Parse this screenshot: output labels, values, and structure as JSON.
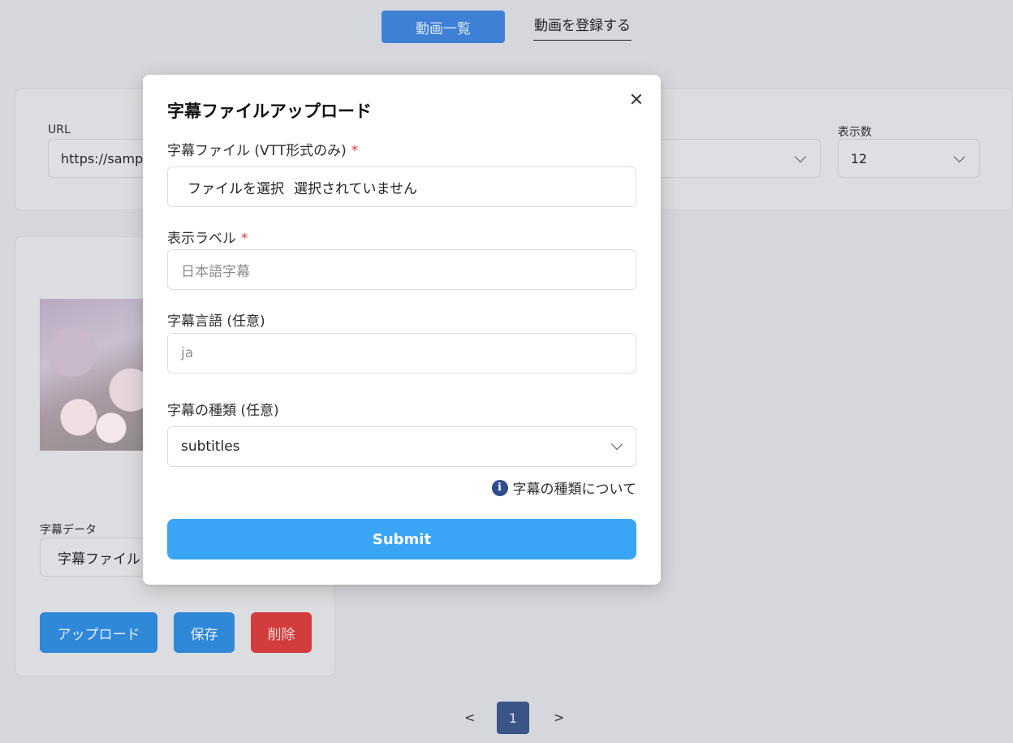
{
  "nav": {
    "active_label": "動画一覧",
    "register_label": "動画を登録する"
  },
  "filters": {
    "url_label": "URL",
    "url_value": "https://samp",
    "per_page_label": "表示数",
    "per_page_value": "12"
  },
  "video_card": {
    "subtitle_label": "字幕データ",
    "subtitle_value": "字幕ファイル",
    "upload_label": "アップロード",
    "save_label": "保存",
    "delete_label": "削除"
  },
  "pagination": {
    "prev": "<",
    "current": "1",
    "next": ">"
  },
  "modal": {
    "title": "字幕ファイルアップロード",
    "file_label": "字幕ファイル (VTT形式のみ)",
    "required_mark": "*",
    "file_button": "ファイルを選択",
    "file_status": "選択されていません",
    "display_label": "表示ラベル",
    "display_placeholder": "日本語字幕",
    "lang_label": "字幕言語 (任意)",
    "lang_placeholder": "ja",
    "kind_label": "字幕の種類 (任意)",
    "kind_value": "subtitles",
    "info_text": "字幕の種類について",
    "submit_label": "Submit"
  },
  "colors": {
    "primary": "#3ba5f5",
    "nav_active": "#3d80d6",
    "danger": "#d23c3c",
    "pager_active": "#3a5586"
  }
}
